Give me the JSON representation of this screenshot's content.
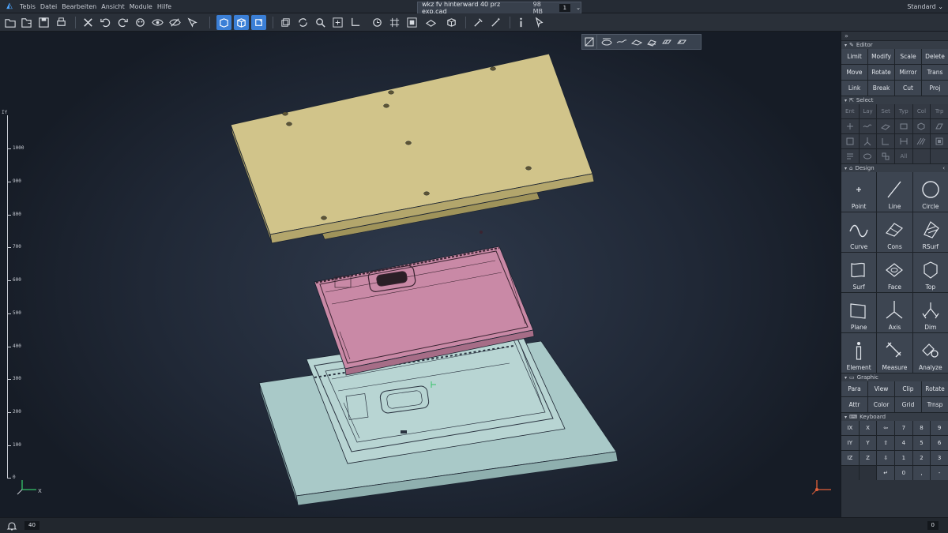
{
  "menubar": {
    "app_name": "Tebis",
    "items": [
      "Datei",
      "Bearbeiten",
      "Ansicht",
      "Module",
      "Hilfe"
    ],
    "document": {
      "name": "wkz fv hinterward 40 prz exp.cad",
      "size": "98 MB",
      "index": "1"
    },
    "workspace": "Standard"
  },
  "viewport": {
    "ruler_labels": [
      "IY",
      "1000",
      "900",
      "800",
      "700",
      "600",
      "500",
      "400",
      "300",
      "200",
      "100",
      "0"
    ],
    "axis_label": "X",
    "colors": {
      "top_plate": "#d1c48a",
      "pink_part": "#c989a6",
      "base_plate": "#a9c9c8"
    }
  },
  "panel": {
    "editor": {
      "title": "Editor",
      "buttons": [
        "Limit",
        "Modify",
        "Scale",
        "Delete",
        "Move",
        "Rotate",
        "Mirror",
        "Trans",
        "Link",
        "Break",
        "Cut",
        "Proj"
      ]
    },
    "select": {
      "title": "Select",
      "buttons": [
        "Ent",
        "Lay",
        "Set",
        "Typ",
        "Col",
        "Trp"
      ],
      "last_label": "All"
    },
    "design": {
      "title": "Design",
      "buttons": [
        "Point",
        "Line",
        "Circle",
        "Curve",
        "Cons",
        "RSurf",
        "Surf",
        "Face",
        "Top",
        "Plane",
        "Axis",
        "Dim",
        "Element",
        "Measure",
        "Analyze"
      ]
    },
    "graphic": {
      "title": "Graphic",
      "buttons": [
        "Para",
        "View",
        "Clip",
        "Rotate",
        "Attr",
        "Color",
        "Grid",
        "Trnsp"
      ]
    },
    "keyboard": {
      "title": "Keyboard",
      "keys": [
        "IX",
        "X",
        "⇦",
        "7",
        "8",
        "9",
        "IY",
        "Y",
        "⇧",
        "4",
        "5",
        "6",
        "IZ",
        "Z",
        "⇩",
        "1",
        "2",
        "3",
        "",
        "",
        "",
        "0",
        ",",
        "-"
      ]
    }
  },
  "statusbar": {
    "messages": "40",
    "right_count": "0"
  }
}
